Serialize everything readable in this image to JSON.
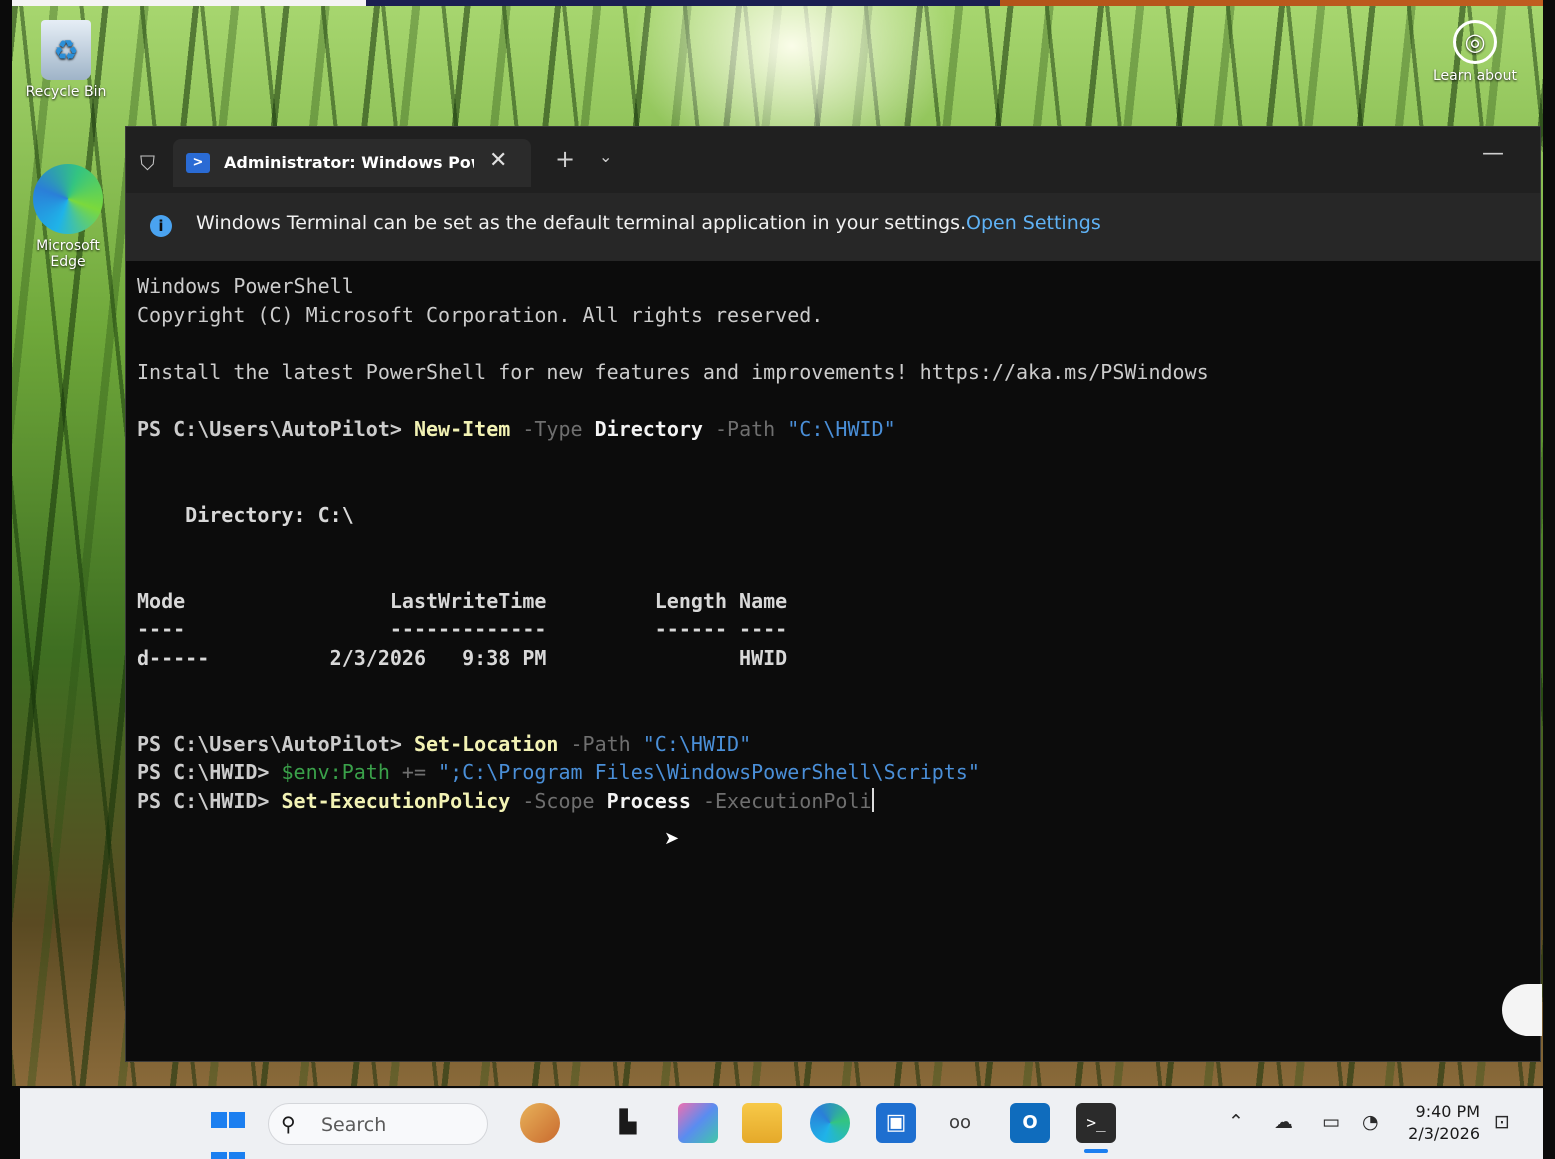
{
  "desktop": {
    "icons": [
      {
        "label": "Recycle Bin"
      },
      {
        "label": "Microsoft Edge"
      },
      {
        "label": "Learn about"
      }
    ]
  },
  "terminal": {
    "tab_title": "Administrator: Windows Powe",
    "info_message": "Windows Terminal can be set as the default terminal application in your settings.",
    "info_link": "Open Settings",
    "banner": [
      "Windows PowerShell",
      "Copyright (C) Microsoft Corporation. All rights reserved.",
      "",
      "Install the latest PowerShell for new features and improvements! https://aka.ms/PSWindows"
    ],
    "commands": [
      {
        "prompt": "PS C:\\Users\\AutoPilot> ",
        "cmdlet": "New-Item",
        "p1": " -Type ",
        "v1": "Directory",
        "p2": " -Path ",
        "s1": "\"C:\\HWID\""
      },
      {
        "prompt": "PS C:\\Users\\AutoPilot> ",
        "cmdlet": "Set-Location",
        "p1": " -Path ",
        "s1": "\"C:\\HWID\""
      },
      {
        "prompt": "PS C:\\HWID> ",
        "var": "$env:Path",
        "op": " += ",
        "s1": "\";C:\\Program Files\\WindowsPowerShell\\Scripts\""
      },
      {
        "prompt": "PS C:\\HWID> ",
        "cmdlet": "Set-ExecutionPolicy",
        "p1": " -Scope ",
        "v1": "Process",
        "p2": " -ExecutionPoli"
      }
    ],
    "dir_label": "    Directory: C:\\",
    "table": {
      "header": "Mode                 LastWriteTime         Length Name",
      "rule": "----                 -------------         ------ ----",
      "rows": [
        "d-----          2/3/2026   9:38 PM                HWID"
      ]
    }
  },
  "taskbar": {
    "search_placeholder": "Search",
    "time": "9:40 PM",
    "date": "2/3/2026",
    "terminal_glyph": ">_",
    "outlook_glyph": "O"
  },
  "colors": {
    "terminal_bg": "#0c0c0c",
    "cmdlet": "#f2f2b4",
    "string": "#4a8fd8",
    "variable": "#3aa14a",
    "link": "#5fb2f5",
    "accent": "#1b7ff0"
  }
}
